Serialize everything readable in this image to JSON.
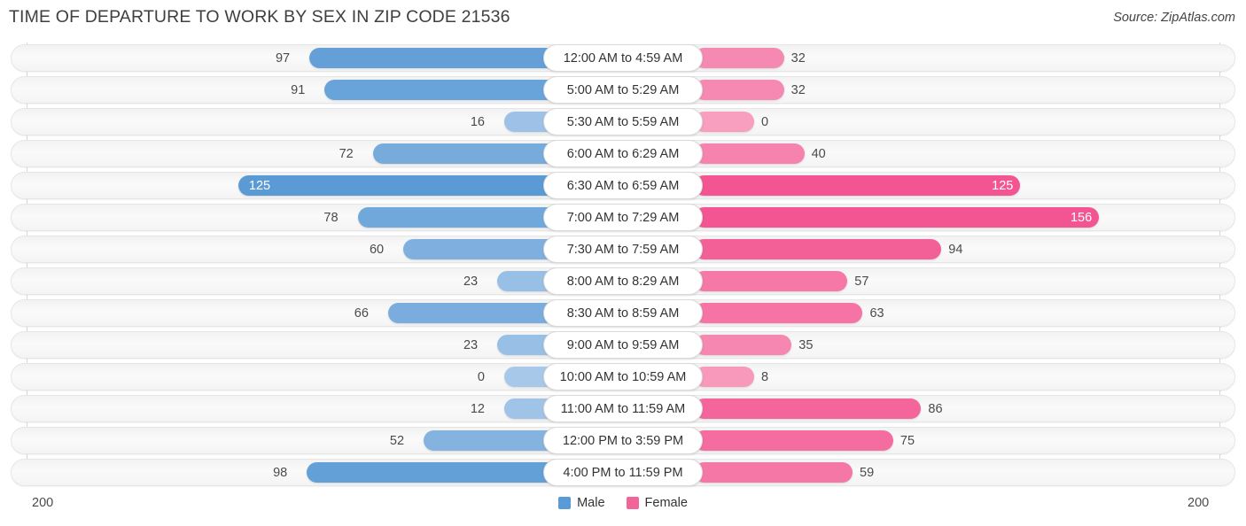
{
  "header": {
    "title": "TIME OF DEPARTURE TO WORK BY SEX IN ZIP CODE 21536",
    "source": "Source: ZipAtlas.com"
  },
  "legend": {
    "male_label": "Male",
    "female_label": "Female",
    "male_color": "#5b9bd5",
    "female_color": "#f2659a"
  },
  "axis": {
    "min_label": "200",
    "max_label": "200",
    "scale_max": 200
  },
  "chart_data": {
    "type": "bar",
    "orientation": "horizontal-diverging",
    "title": "TIME OF DEPARTURE TO WORK BY SEX IN ZIP CODE 21536",
    "xlabel": "",
    "ylabel": "",
    "xlim": [
      200,
      200
    ],
    "grid": true,
    "legend_position": "bottom-center",
    "categories": [
      "12:00 AM to 4:59 AM",
      "5:00 AM to 5:29 AM",
      "5:30 AM to 5:59 AM",
      "6:00 AM to 6:29 AM",
      "6:30 AM to 6:59 AM",
      "7:00 AM to 7:29 AM",
      "7:30 AM to 7:59 AM",
      "8:00 AM to 8:29 AM",
      "8:30 AM to 8:59 AM",
      "9:00 AM to 9:59 AM",
      "10:00 AM to 10:59 AM",
      "11:00 AM to 11:59 AM",
      "12:00 PM to 3:59 PM",
      "4:00 PM to 11:59 PM"
    ],
    "series": [
      {
        "name": "Male",
        "color": "#5b9bd5",
        "values": [
          97,
          91,
          16,
          72,
          125,
          78,
          60,
          23,
          66,
          23,
          0,
          12,
          52,
          98
        ]
      },
      {
        "name": "Female",
        "color": "#f2659a",
        "values": [
          32,
          32,
          0,
          40,
          125,
          156,
          94,
          57,
          63,
          35,
          8,
          86,
          75,
          59
        ]
      }
    ]
  }
}
